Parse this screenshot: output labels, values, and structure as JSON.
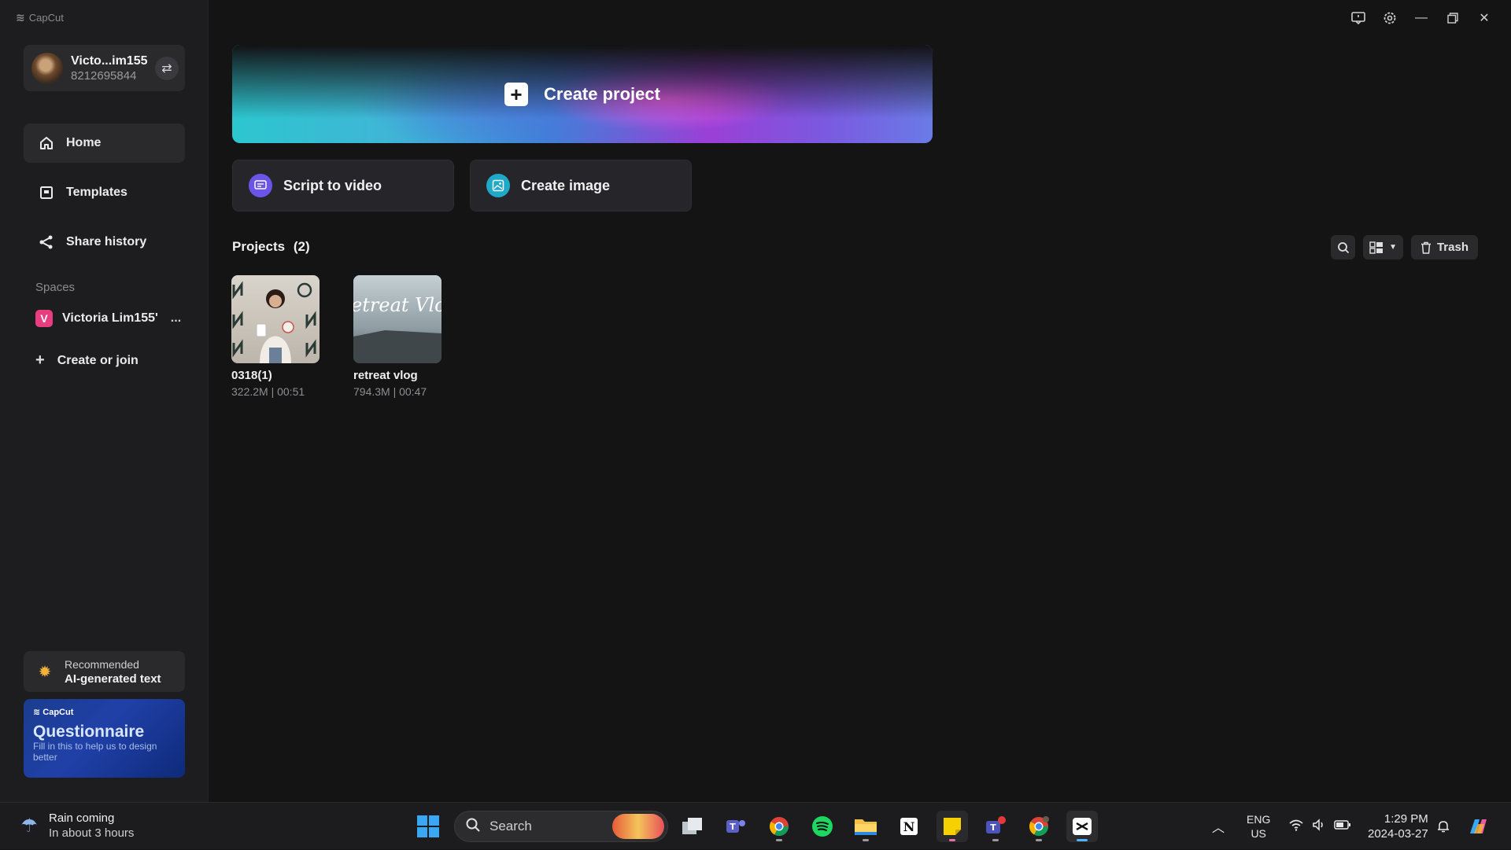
{
  "app": {
    "brand": "CapCut",
    "account": {
      "name": "Victo...im155",
      "id": "8212695844"
    },
    "nav": [
      {
        "label": "Home",
        "icon": "home-icon",
        "active": true
      },
      {
        "label": "Templates",
        "icon": "templates-icon",
        "active": false
      },
      {
        "label": "Share history",
        "icon": "share-icon",
        "active": false
      }
    ],
    "spaces": {
      "label": "Spaces",
      "item": {
        "badge": "V",
        "name": "Victoria Lim155'",
        "more": "...",
        "badge_color": "#e83d7f"
      },
      "create_join": "Create or join"
    },
    "recommended": {
      "top": "Recommended",
      "bottom": "AI-generated text"
    },
    "questionnaire": {
      "brand": "CapCut",
      "title": "Questionnaire",
      "subtitle": "Fill in this to help us to design better"
    }
  },
  "main": {
    "create_project": "Create project",
    "actions": [
      {
        "label": "Script to video",
        "icon": "script-icon",
        "color": "#6b55e8"
      },
      {
        "label": "Create image",
        "icon": "image-icon",
        "color": "#1fa9c9"
      }
    ],
    "projects_title": "Projects",
    "projects_count": "(2)",
    "trash_label": "Trash",
    "projects": [
      {
        "name": "0318(1)",
        "meta": "322.2M | 00:51"
      },
      {
        "name": "retreat vlog",
        "meta": "794.3M | 00:47",
        "thumb_text": "Retreat Vlog"
      }
    ]
  },
  "taskbar": {
    "weather": {
      "line1": "Rain coming",
      "line2": "In about 3 hours"
    },
    "search_placeholder": "Search",
    "lang": {
      "line1": "ENG",
      "line2": "US"
    },
    "clock": {
      "time": "1:29 PM",
      "date": "2024-03-27"
    }
  },
  "colors": {
    "accent_pink": "#e83d7f",
    "hero_left": "#2cc6cf",
    "hero_mid": "#9b3fd6",
    "hero_right": "#6a7be6"
  }
}
